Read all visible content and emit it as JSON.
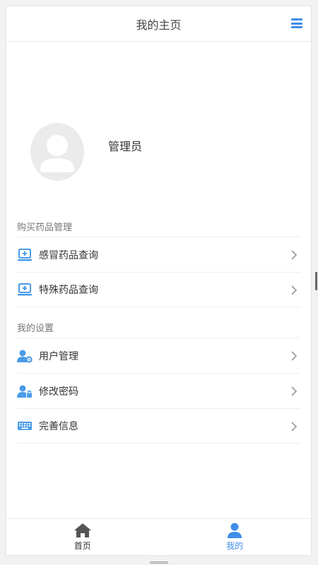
{
  "header": {
    "title": "我的主页",
    "menu_icon": "menu-icon"
  },
  "profile": {
    "name": "管理员",
    "avatar_icon": "user-avatar-icon"
  },
  "sections": {
    "purchase": {
      "title": "购买药品管理",
      "items": [
        {
          "label": "感冒药品查询",
          "icon": "computer-plus-icon"
        },
        {
          "label": "特殊药品查询",
          "icon": "computer-plus-icon"
        }
      ]
    },
    "settings": {
      "title": "我的设置",
      "items": [
        {
          "label": "用户管理",
          "icon": "user-gear-icon"
        },
        {
          "label": "修改密码",
          "icon": "user-lock-icon"
        },
        {
          "label": "完善信息",
          "icon": "keyboard-icon"
        }
      ]
    }
  },
  "tabbar": {
    "home": {
      "label": "首页",
      "icon": "home-icon"
    },
    "me": {
      "label": "我的",
      "icon": "person-icon",
      "active": true
    }
  },
  "colors": {
    "accent": "#3d8de8",
    "icon_blue": "#4a9be8",
    "text": "#333333",
    "muted": "#777777"
  }
}
